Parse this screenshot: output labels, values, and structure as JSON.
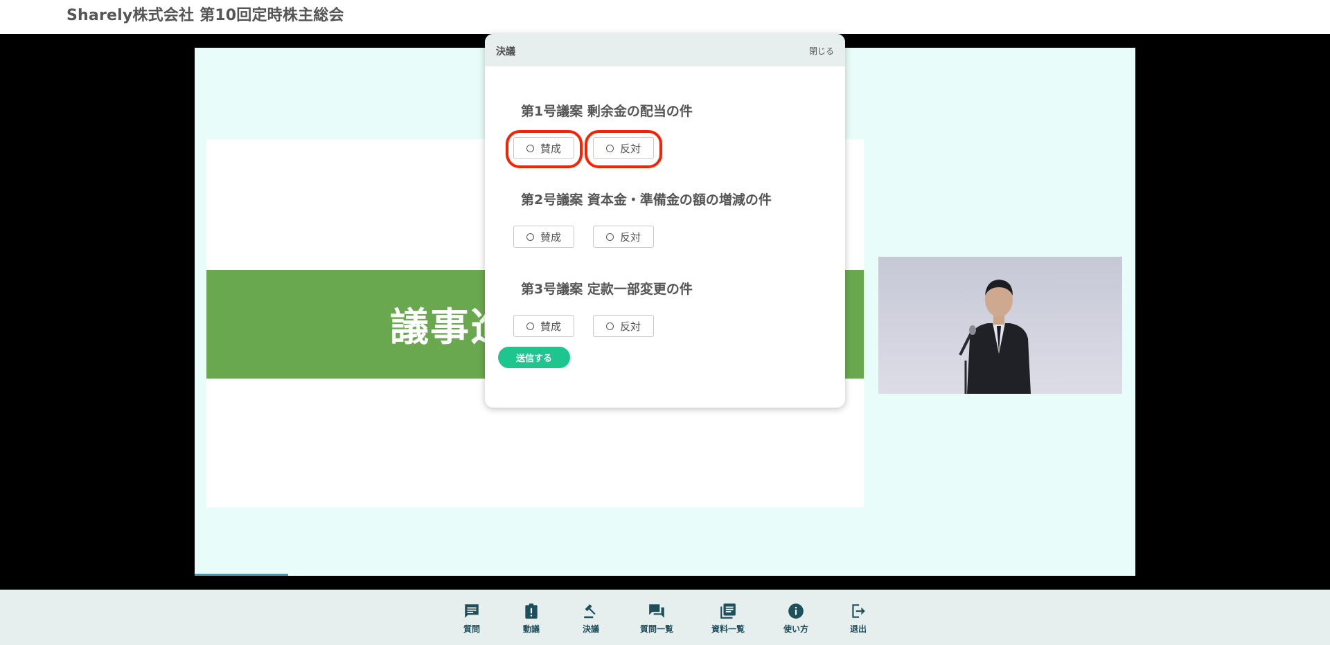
{
  "header": {
    "title": "Sharely株式会社 第10回定時株主総会"
  },
  "slide": {
    "band_text": "議事進行"
  },
  "modal": {
    "title": "決議",
    "close_label": "閉じる",
    "proposals": [
      {
        "title": "第1号議案 剰余金の配当の件",
        "yes_label": "賛成",
        "no_label": "反対",
        "highlighted": true
      },
      {
        "title": "第2号議案 資本金・準備金の額の増減の件",
        "yes_label": "賛成",
        "no_label": "反対",
        "highlighted": false
      },
      {
        "title": "第3号議案 定款一部変更の件",
        "yes_label": "賛成",
        "no_label": "反対",
        "highlighted": false
      }
    ],
    "submit_label": "送信する"
  },
  "toolbar": {
    "items": [
      {
        "label": "質問",
        "icon": "comment-icon"
      },
      {
        "label": "動議",
        "icon": "clipboard-alert-icon"
      },
      {
        "label": "決議",
        "icon": "gavel-icon"
      },
      {
        "label": "質問一覧",
        "icon": "forum-icon"
      },
      {
        "label": "資料一覧",
        "icon": "library-books-icon"
      },
      {
        "label": "使い方",
        "icon": "info-icon"
      },
      {
        "label": "退出",
        "icon": "logout-icon"
      }
    ]
  },
  "colors": {
    "accent_green": "#1ec58f",
    "toolbar_text": "#1e4f5c",
    "annotation_red": "#ff1f00",
    "slide_band": "#6aa84f",
    "slide_bg": "#e8fdf9"
  }
}
